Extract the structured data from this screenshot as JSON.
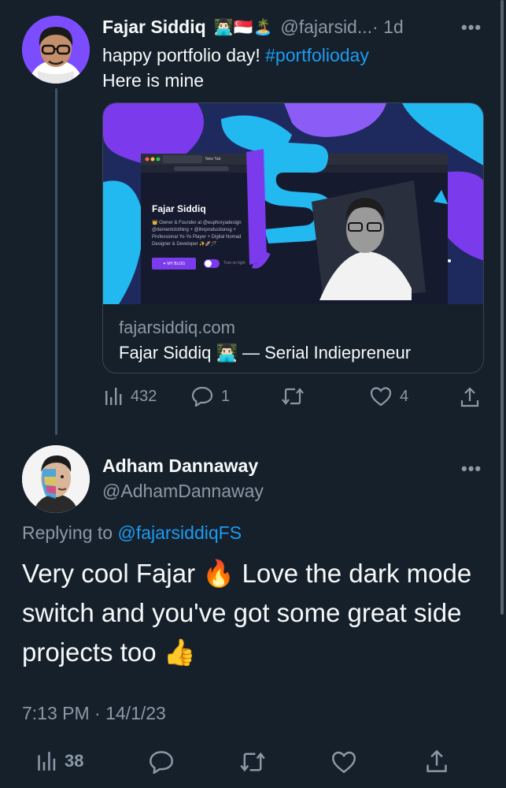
{
  "tweet1": {
    "author_name": "Fajar Siddiq",
    "author_emojis": "👨🏻‍💻🇸🇬🏝️",
    "handle": "@fajarsid...",
    "time": "· 1d",
    "more": "•••",
    "line1_text": "happy portfolio day! ",
    "hashtag": "#portfolioday",
    "line2_text": "Here is mine",
    "card": {
      "domain": "fajarsiddiq.com",
      "title": "Fajar Siddiq 👨🏻‍💻 — Serial Indiepreneur",
      "preview": {
        "browser_tab": "New Tab",
        "site_name": "Fajar Siddiq",
        "bio_line1": "👑 Owner & Founder at @euphoryadesign",
        "bio_line2": "@dementclothing + @ilmproductionsg +",
        "bio_line3": "Professional Yo-Yo Player + Digital Nomad",
        "bio_line4": "Designer & Developer ✨🚀🪄",
        "blog_button": "✦ MY BLOG",
        "toggle_label": "Turn on light"
      }
    },
    "actions": {
      "views": "432",
      "replies": "1",
      "retweets": "",
      "likes": "4"
    }
  },
  "tweet2": {
    "author_name": "Adham Dannaway",
    "handle": "@AdhamDannaway",
    "more": "•••",
    "replying_prefix": "Replying to ",
    "replying_mention": "@fajarsiddiqFS",
    "text": "Very cool Fajar 🔥 Love the dark mode switch and you've got some great side projects too 👍",
    "timestamp": "7:13 PM · 14/1/23",
    "actions": {
      "views": "38"
    }
  },
  "colors": {
    "background": "#15202b",
    "text": "#f7f9f9",
    "secondary": "#8b98a5",
    "accent": "#1d9bf0",
    "border": "#38444d"
  },
  "icons": [
    "views-icon",
    "reply-icon",
    "retweet-icon",
    "like-icon",
    "share-icon",
    "more-icon"
  ]
}
